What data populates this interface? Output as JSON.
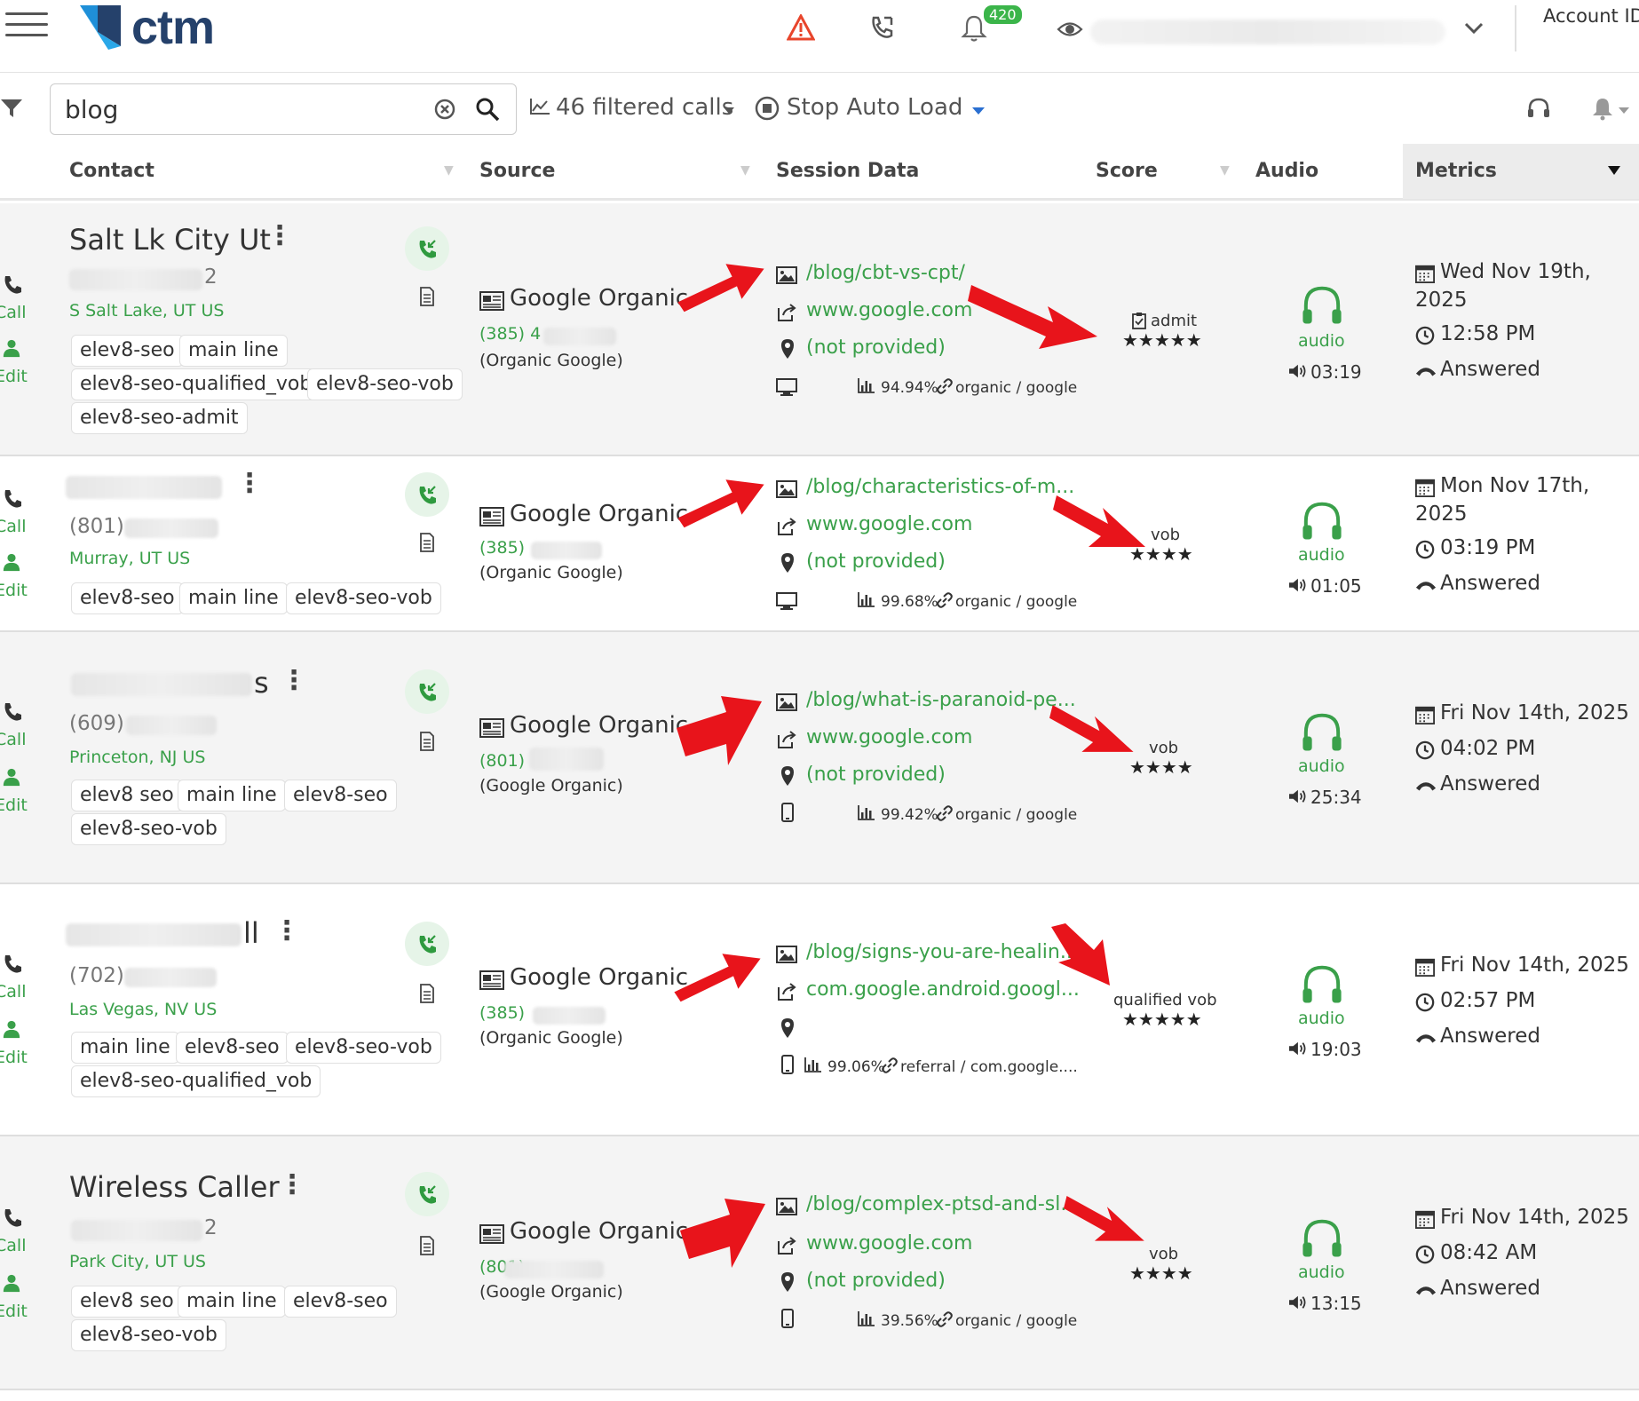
{
  "header": {
    "logo_text": "ctm",
    "notification_count": "420",
    "account_label": "Account ID"
  },
  "toolbar": {
    "search_value": "blog",
    "filtered_calls": "46 filtered calls",
    "stop_auto_load": "Stop Auto Load"
  },
  "columns": {
    "contact": "Contact",
    "source": "Source",
    "session": "Session Data",
    "score": "Score",
    "audio": "Audio",
    "metrics": "Metrics"
  },
  "side_actions": {
    "call": "Call",
    "edit": "Edit"
  },
  "rows": [
    {
      "name": "Salt Lk City Ut",
      "phone_suffix": "2",
      "location": "S Salt Lake, UT US",
      "tags": [
        "elev8-seo",
        "main line",
        "elev8-seo-qualified_vob",
        "elev8-seo-vob",
        "elev8-seo-admit"
      ],
      "source": "Google Organic",
      "source_phone": "(385) 4",
      "source_sub": "(Organic Google)",
      "page": "/blog/cbt-vs-cpt/",
      "referrer": "www.google.com",
      "keyword": "(not provided)",
      "percent": "94.94%",
      "medium": "organic / google",
      "score_label": "admit",
      "stars": "★★★★★",
      "audio_label": "audio",
      "duration": "03:19",
      "date_line1": "Wed Nov 19th,",
      "date_line2": "2025",
      "time": "12:58 PM",
      "status": "Answered"
    },
    {
      "name": "",
      "phone": "(801)",
      "location": "Murray, UT US",
      "tags": [
        "elev8-seo",
        "main line",
        "elev8-seo-vob"
      ],
      "source": "Google Organic",
      "source_phone": "(385)",
      "source_sub": "(Organic Google)",
      "page": "/blog/characteristics-of-m...",
      "referrer": "www.google.com",
      "keyword": "(not provided)",
      "percent": "99.68%",
      "medium": "organic / google",
      "score_label": "vob",
      "stars": "★★★★",
      "audio_label": "audio",
      "duration": "01:05",
      "date_line1": "Mon Nov 17th,",
      "date_line2": "2025",
      "time": "03:19 PM",
      "status": "Answered"
    },
    {
      "name": "s",
      "phone": "(609)",
      "location": "Princeton, NJ US",
      "tags": [
        "elev8 seo",
        "main line",
        "elev8-seo",
        "elev8-seo-vob"
      ],
      "source": "Google Organic",
      "source_phone": "(801)",
      "source_sub": "(Google Organic)",
      "page": "/blog/what-is-paranoid-pe...",
      "referrer": "www.google.com",
      "keyword": "(not provided)",
      "percent": "99.42%",
      "medium": "organic / google",
      "score_label": "vob",
      "stars": "★★★★",
      "audio_label": "audio",
      "duration": "25:34",
      "date_line1": "Fri Nov 14th, 2025",
      "time": "04:02 PM",
      "status": "Answered"
    },
    {
      "name": "ll",
      "phone": "(702)",
      "location": "Las Vegas, NV US",
      "tags": [
        "main line",
        "elev8-seo",
        "elev8-seo-vob",
        "elev8-seo-qualified_vob"
      ],
      "source": "Google Organic",
      "source_phone": "(385)",
      "source_sub": "(Organic Google)",
      "page": "/blog/signs-you-are-healin...",
      "referrer": "com.google.android.googl...",
      "keyword": "",
      "percent": "99.06%",
      "medium": "referral / com.google....",
      "score_label": "qualified vob",
      "stars": "★★★★★",
      "audio_label": "audio",
      "duration": "19:03",
      "date_line1": "Fri Nov 14th, 2025",
      "time": "02:57 PM",
      "status": "Answered"
    },
    {
      "name": "Wireless Caller",
      "phone_suffix": "2",
      "location": "Park City, UT US",
      "tags": [
        "elev8 seo",
        "main line",
        "elev8-seo",
        "elev8-seo-vob"
      ],
      "source": "Google Organic",
      "source_phone": "(801)",
      "source_sub": "(Google Organic)",
      "page": "/blog/complex-ptsd-and-sl...",
      "referrer": "www.google.com",
      "keyword": "(not provided)",
      "percent": "39.56%",
      "medium": "organic / google",
      "score_label": "vob",
      "stars": "★★★★",
      "audio_label": "audio",
      "duration": "13:15",
      "date_line1": "Fri Nov 14th, 2025",
      "time": "08:42 AM",
      "status": "Answered"
    }
  ]
}
